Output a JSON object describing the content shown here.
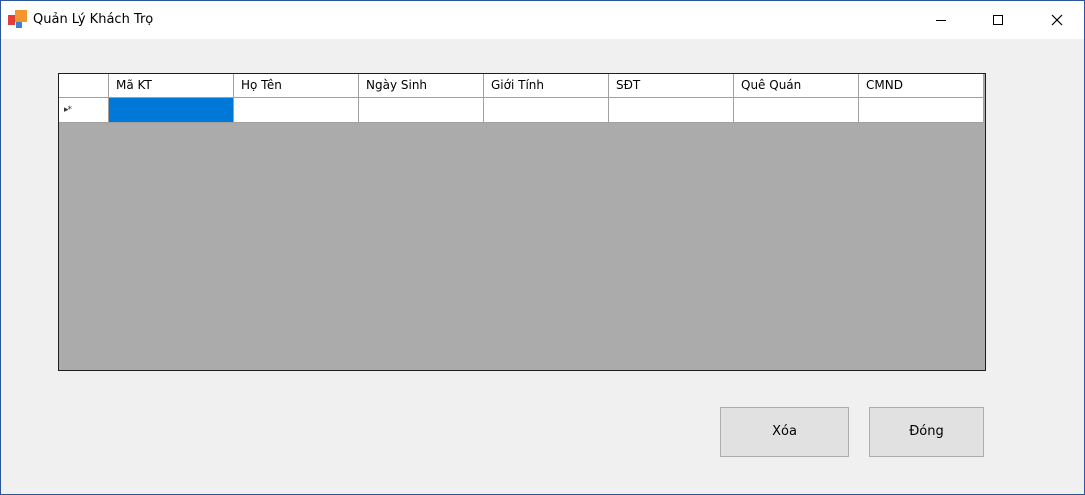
{
  "window": {
    "title": "Quản Lý Khách Trọ",
    "icon": "app-logo-icon",
    "caption_buttons": [
      "minimize-icon",
      "maximize-icon",
      "close-icon"
    ]
  },
  "grid": {
    "columns": [
      "Mã KT",
      "Họ Tên",
      "Ngày Sinh",
      "Giới Tính",
      "SĐT",
      "Quê Quán",
      "CMND"
    ],
    "new_row_glyph": "▸*",
    "rows": [
      [
        "",
        "",
        "",
        "",
        "",
        "",
        ""
      ]
    ],
    "selected_cell": {
      "row": 0,
      "column": "Mã KT"
    },
    "colors": {
      "selection": "#0078d7",
      "empty_area": "#ababab"
    }
  },
  "buttons": {
    "delete_label": "Xóa",
    "close_label": "Đóng"
  },
  "colors": {
    "window_border": "#2b579a",
    "background": "#f0f0f0"
  }
}
